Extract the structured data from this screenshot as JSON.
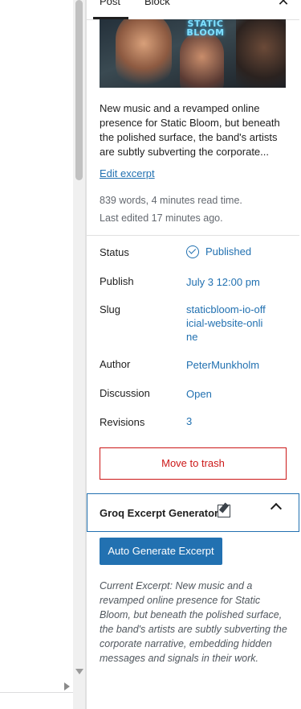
{
  "tabs": {
    "post": "Post",
    "block": "Block"
  },
  "close": "✕",
  "featured_image": {
    "title": "STATIC BLOOM"
  },
  "excerpt": "New music and a revamped online presence for Static Bloom, but beneath the polished surface, the band's artists are subtly subverting the corporate...",
  "edit_excerpt": "Edit excerpt",
  "stats": {
    "words": "839 words, 4 minutes read time.",
    "last_edited": "Last edited 17 minutes ago."
  },
  "details": {
    "status_label": "Status",
    "status_value": "Published",
    "publish_label": "Publish",
    "publish_value": "July 3 12:00 pm",
    "slug_label": "Slug",
    "slug_value": "staticbloom-io-official-website-online",
    "author_label": "Author",
    "author_value": "PeterMunkholm",
    "discussion_label": "Discussion",
    "discussion_value": "Open",
    "revisions_label": "Revisions",
    "revisions_value": "3"
  },
  "trash": "Move to trash",
  "plugin_panel": {
    "title": "Groq Excerpt Generator",
    "button": "Auto Generate Excerpt",
    "current_excerpt": "Current Excerpt: New music and a revamped online presence for Static Bloom, but beneath the polished surface, the band's artists are subtly subverting the corporate narrative, embedding hidden messages and signals in their work."
  },
  "colors": {
    "link": "#2271b1",
    "danger": "#cc1818",
    "primary": "#2271b1"
  }
}
